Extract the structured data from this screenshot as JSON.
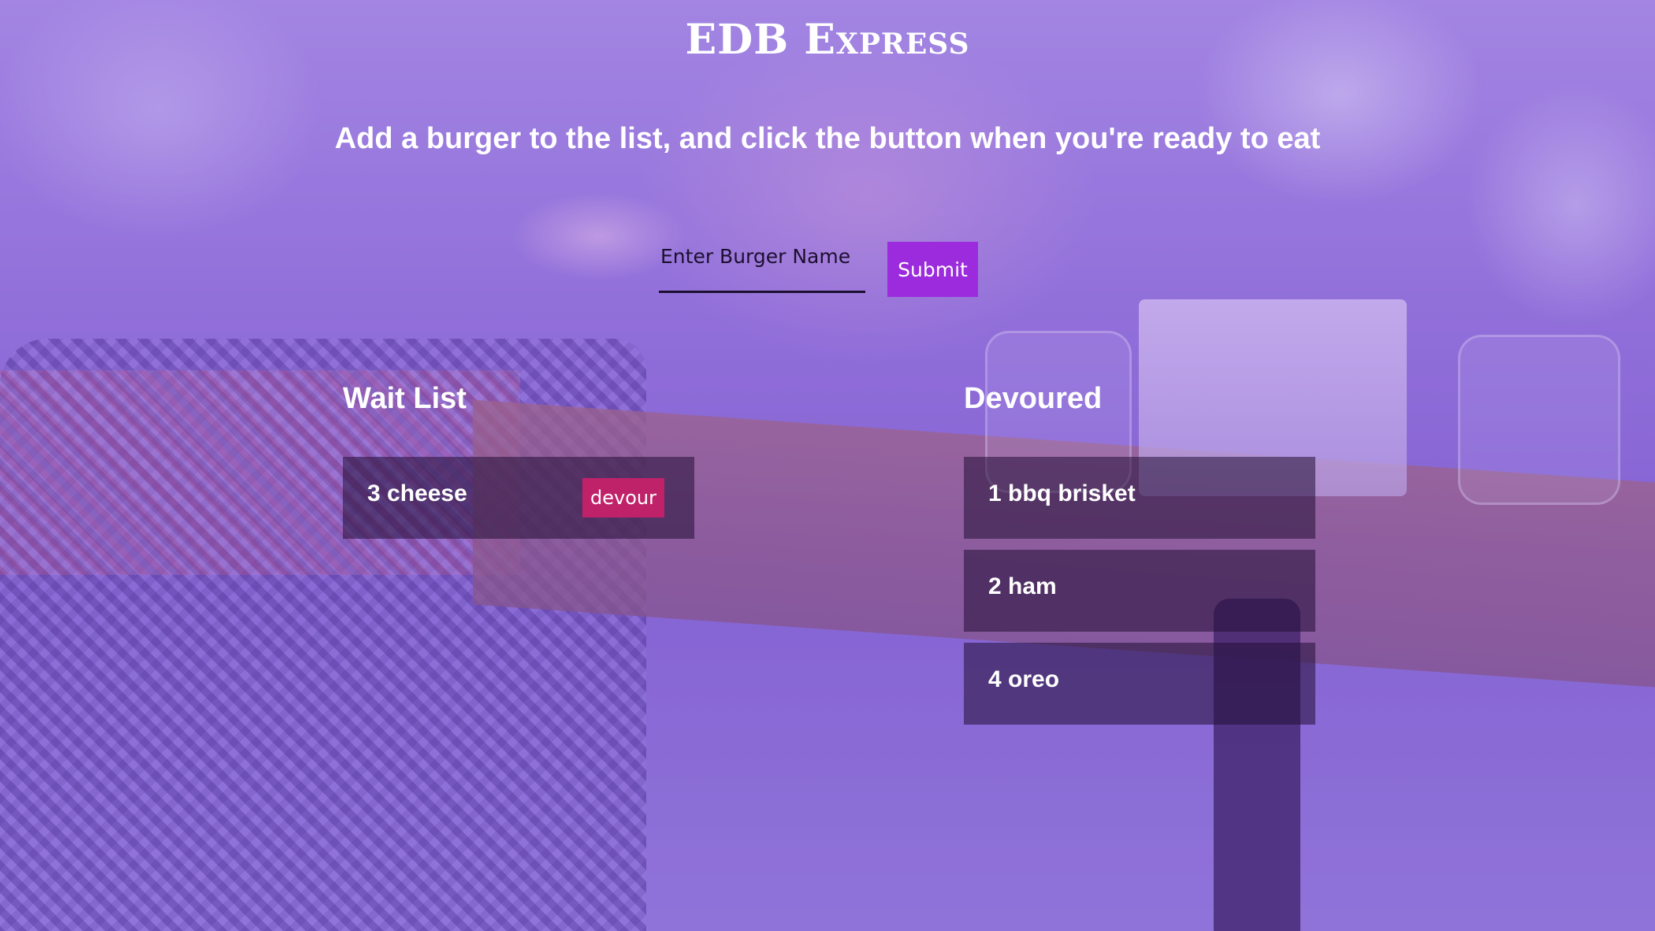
{
  "header": {
    "title": "EDB Express",
    "subtitle": "Add a burger to the list, and click the button when you're ready to eat"
  },
  "form": {
    "input_placeholder": "Enter Burger Name",
    "input_value": "",
    "submit_label": "Submit"
  },
  "wait_list": {
    "heading": "Wait List",
    "items": [
      {
        "label": "3 cheese",
        "button_label": "devour"
      }
    ]
  },
  "devoured": {
    "heading": "Devoured",
    "items": [
      {
        "label": "1 bbq brisket"
      },
      {
        "label": "2 ham"
      },
      {
        "label": "4 oreo"
      }
    ]
  },
  "colors": {
    "submit_button": "#9b2bdc",
    "devour_button": "#c0226a",
    "overlay": "#7846dc"
  }
}
